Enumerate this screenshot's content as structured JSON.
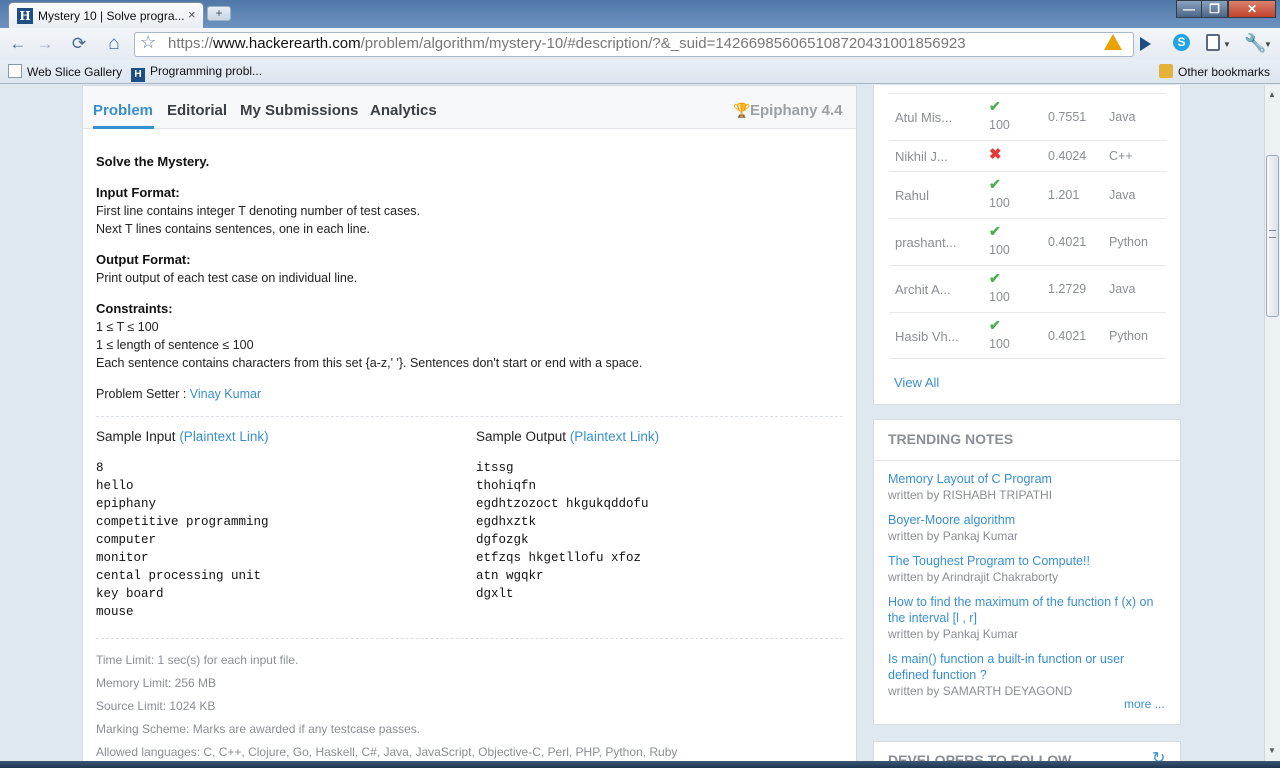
{
  "browser": {
    "tab_title": "Mystery 10 | Solve progra...",
    "tab_close": "×",
    "new_tab": "+",
    "url_scheme": "https://",
    "url_host": "www.hackerearth.com",
    "url_path": "/problem/algorithm/mystery-10/#description/?&_suid=142669856065108720431001856923",
    "bookmarks": [
      {
        "label": "Web Slice Gallery",
        "icon": "page-icon"
      },
      {
        "label": "Programming probl...",
        "icon": "hackerearth-icon"
      }
    ],
    "other_bookmarks": "Other bookmarks",
    "nav_icons": {
      "back": "←",
      "forward": "→",
      "reload": "⟳",
      "home": "⌂",
      "star": "☆",
      "wrench": "🔧"
    }
  },
  "problem_tabs": {
    "tabs": [
      "Problem",
      "Editorial",
      "My Submissions",
      "Analytics"
    ],
    "active": "Problem",
    "contest": "Epiphany 4.4",
    "trophy": "🏆"
  },
  "problem": {
    "title": "Solve the Mystery.",
    "input_format_h": "Input Format:",
    "input_format_lines": [
      "First line contains integer T denoting number of test cases.",
      "Next T lines contains sentences, one in each line."
    ],
    "output_format_h": "Output Format:",
    "output_format_line": "Print output of each test case on individual line.",
    "constraints_h": "Constraints:",
    "constraints_lines": [
      "1 ≤ T ≤ 100",
      "1 ≤ length of sentence ≤ 100",
      "Each sentence contains characters from this set {a-z,' '}. Sentences don't start or end with a space."
    ],
    "setter_label": "Problem Setter : ",
    "setter_name": "Vinay Kumar",
    "sample_input_label": "Sample Input ",
    "sample_output_label": "Sample Output ",
    "plaintext_link": "(Plaintext Link)",
    "sample_input": "8\nhello\nepiphany\ncompetitive programming\ncomputer\nmonitor\ncental processing unit\nkey board\nmouse",
    "sample_output": "itssg\nthohiqfn\negdhtzozoct hkgukqddofu\negdhxztk\ndgfozgk\netfzqs hkgetllofu xfoz\natn wgqkr\ndgxlt",
    "time_limit": "Time Limit: 1 sec(s) for each input file.",
    "memory_limit": "Memory Limit: 256 MB",
    "source_limit": "Source Limit: 1024 KB",
    "marking_scheme": "Marking Scheme: Marks are awarded if any testcase passes.",
    "allowed_languages": "Allowed languages: C, C++, Clojure, Go, Haskell, C#, Java, JavaScript, Objective-C, Perl, PHP, Python, Ruby"
  },
  "submissions": {
    "partial_score_top": "100",
    "rows": [
      {
        "name": "Atul Mis...",
        "status": "✔",
        "score": "100",
        "time": "0.7551",
        "lang": "Java"
      },
      {
        "name": "Nikhil J...",
        "status": "✖",
        "score": "",
        "time": "0.4024",
        "lang": "C++"
      },
      {
        "name": "Rahul",
        "status": "✔",
        "score": "100",
        "time": "1.201",
        "lang": "Java"
      },
      {
        "name": "prashant...",
        "status": "✔",
        "score": "100",
        "time": "0.4021",
        "lang": "Python"
      },
      {
        "name": "Archit A...",
        "status": "✔",
        "score": "100",
        "time": "1.2729",
        "lang": "Java"
      },
      {
        "name": "Hasib Vh...",
        "status": "✔",
        "score": "100",
        "time": "0.4021",
        "lang": "Python"
      }
    ],
    "view_all": "View All"
  },
  "trending": {
    "heading": "TRENDING NOTES",
    "written_by": "written by ",
    "notes": [
      {
        "title": "Memory Layout of C Program",
        "author": "RISHABH TRIPATHI"
      },
      {
        "title": "Boyer-Moore algorithm",
        "author": "Pankaj Kumar"
      },
      {
        "title": "The Toughest Program to Compute!!",
        "author": "Arindrajit Chakraborty"
      },
      {
        "title": "How to find the maximum of the function f (x) on the interval [l , r]",
        "author": "Pankaj Kumar"
      },
      {
        "title": "Is main() function a built-in function or user defined function ?",
        "author": "SAMARTH DEYAGOND"
      }
    ],
    "more": "more ..."
  },
  "developers": {
    "heading": "DEVELOPERS TO FOLLOW"
  },
  "colors": {
    "accent": "#3a8fcf",
    "success": "#4caf50",
    "fail": "#e53935",
    "muted": "#8a8f95"
  }
}
